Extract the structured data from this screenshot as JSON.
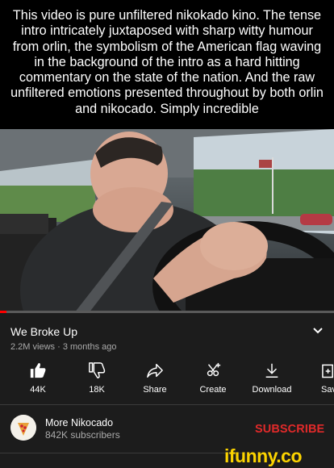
{
  "caption": "This video is  pure unfiltered nikokado kino. The tense intro intricately juxtaposed with sharp witty humour from orlin, the symbolism of the American flag waving in the background of the intro as a hard hitting commentary on the state of the nation. And the raw unfiltered emotions presented throughout by both orlin and nikocado. Simply incredible",
  "video": {
    "title": "We Broke Up",
    "views": "2.2M views",
    "age": "3 months ago",
    "progress": 0.02
  },
  "actions": [
    {
      "icon": "thumbs-up-icon",
      "label": "44K"
    },
    {
      "icon": "thumbs-down-icon",
      "label": "18K"
    },
    {
      "icon": "share-icon",
      "label": "Share"
    },
    {
      "icon": "create-icon",
      "label": "Create"
    },
    {
      "icon": "download-icon",
      "label": "Download"
    },
    {
      "icon": "save-icon",
      "label": "Sav"
    }
  ],
  "channel": {
    "name": "More Nikocado",
    "subscribers": "842K subscribers",
    "subscribe_label": "SUBSCRIBE"
  },
  "watermark": "ifunny.co",
  "colors": {
    "accent": "#e12a2a",
    "progress": "#ff0000",
    "watermark": "#fbd300",
    "panel": "#1c1c1c"
  }
}
